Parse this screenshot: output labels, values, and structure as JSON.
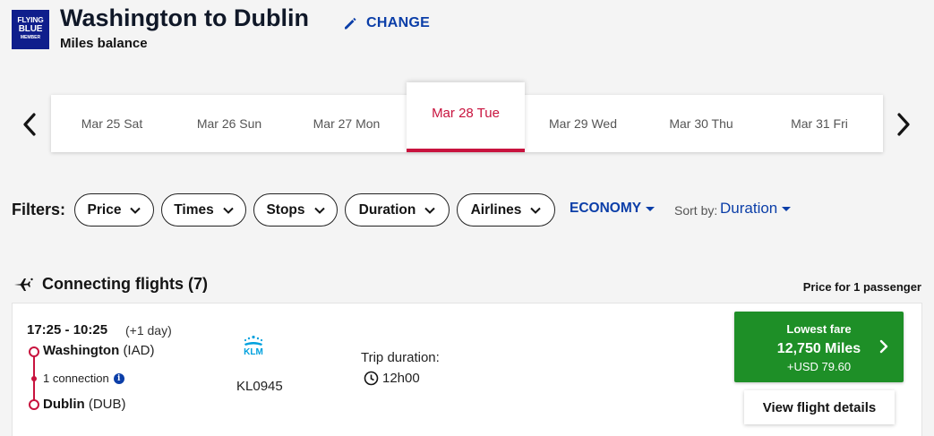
{
  "header": {
    "logo_line1": "FLYING",
    "logo_line2": "BLUE",
    "logo_line3": "MEMBER",
    "title": "Washington to Dublin",
    "subtitle": "Miles balance",
    "change_label": "CHANGE"
  },
  "dates": {
    "items": [
      {
        "label": "Mar 25 Sat"
      },
      {
        "label": "Mar 26 Sun"
      },
      {
        "label": "Mar 27 Mon"
      },
      {
        "label": "Mar 28 Tue"
      },
      {
        "label": "Mar 29 Wed"
      },
      {
        "label": "Mar 30 Thu"
      },
      {
        "label": "Mar 31 Fri"
      }
    ],
    "selected": "Mar 28 Tue"
  },
  "filters": {
    "label": "Filters:",
    "pills": [
      {
        "label": "Price"
      },
      {
        "label": "Times"
      },
      {
        "label": "Stops"
      },
      {
        "label": "Duration"
      },
      {
        "label": "Airlines"
      }
    ],
    "cabin": "ECONOMY",
    "sort_label": "Sort by:",
    "sort_value": "Duration"
  },
  "results": {
    "section_title": "Connecting flights (7)",
    "price_note": "Price for 1 passenger",
    "flights": [
      {
        "times": "17:25 - 10:25",
        "plus_day": "(+1 day)",
        "origin_city": "Washington",
        "origin_code": "(IAD)",
        "connection": "1 connection",
        "dest_city": "Dublin",
        "dest_code": "(DUB)",
        "airline_logo_text": "KLM",
        "flight_number": "KL0945",
        "trip_label": "Trip duration:",
        "trip_duration": "12h00",
        "fare_label": "Lowest fare",
        "fare_miles": "12,750 Miles",
        "fare_usd": "+USD 79.60",
        "details_label": "View flight details"
      }
    ]
  },
  "colors": {
    "brand_blue": "#0f1e8c",
    "link_blue": "#0b3ea8",
    "accent_red": "#c8133e",
    "fare_green": "#1e8f27",
    "klm_blue": "#00a1de"
  }
}
